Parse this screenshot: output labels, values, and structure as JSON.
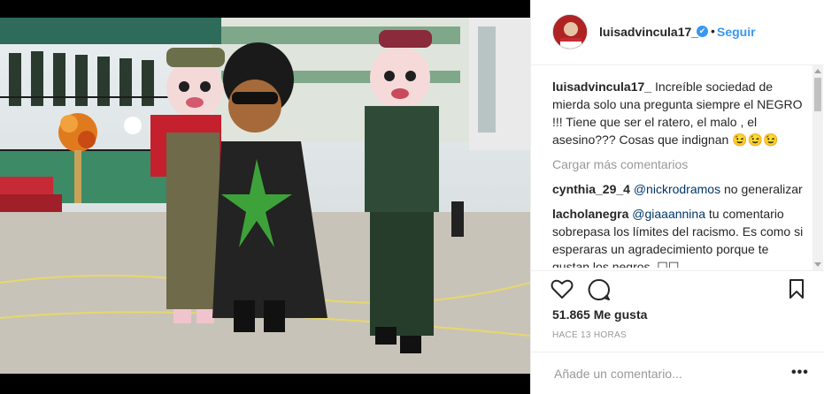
{
  "post": {
    "username": "luisadvincula17_",
    "verified_mark": "✔",
    "dot": "•",
    "follow_label": "Seguir"
  },
  "caption": {
    "user": "luisadvincula17_",
    "text": "Increíble sociedad de mierda solo una pregunta siempre el NEGRO !!! Tiene que ser el ratero, el malo , el asesino??? Cosas que indignan 😉😉😉"
  },
  "load_more_label": "Cargar más comentarios",
  "comments": [
    {
      "user": "cynthia_29_4",
      "mention": "@nickrodramos",
      "text": "no generalizar"
    },
    {
      "user": "lacholanegra",
      "mention": "@giaaannina",
      "text": "tu comentario sobrepasa los límites del racismo. Es como si esperaras un agradecimiento porque te gustan los negros. ☐☐"
    }
  ],
  "stats": {
    "likes": "51.865 Me gusta",
    "time": "HACE 13 HORAS"
  },
  "add_comment": {
    "placeholder": "Añade un comentario...",
    "more_label": "•••"
  },
  "icons": {
    "like": "heart-icon",
    "comment": "comment-icon",
    "save": "bookmark-icon",
    "verified": "verified-badge-icon",
    "more": "more-options-icon"
  },
  "colors": {
    "link": "#3897f0",
    "verified": "#3897f0",
    "muted": "#999999",
    "text": "#262626"
  }
}
